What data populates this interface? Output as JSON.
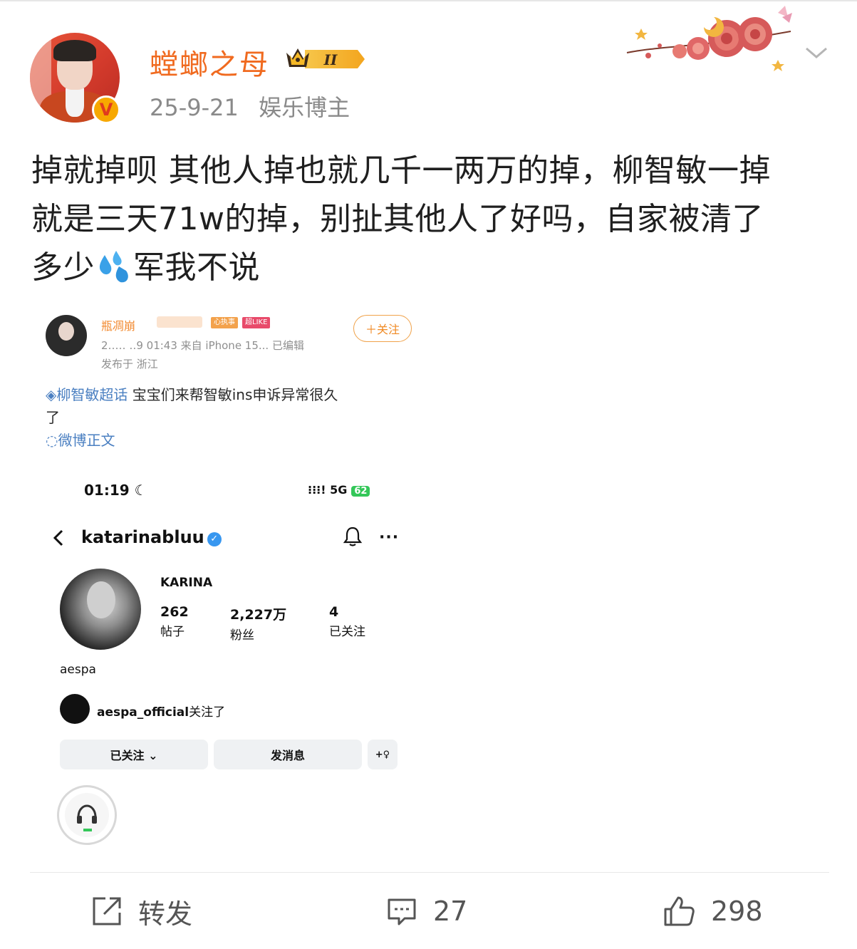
{
  "post": {
    "username": "螳螂之母",
    "vip_label": "II",
    "date": "25-9-21",
    "user_tag": "娱乐博主",
    "text_line1": "掉就掉呗  其他人掉也就几千一两万的掉，柳智敏一掉",
    "text_line2": "就是三天71w的掉，别扯其他人了好吗，自家被清了",
    "text_line3a": "多少",
    "text_line3b": "军我不说"
  },
  "embed": {
    "name_fragment": "瓶凋崩",
    "tag1": "心执事",
    "tag2": "超LIKE",
    "follow": "＋关注",
    "time_line": "2…‥ ‥9 01:43  来自 iPhone 15...  已编辑",
    "location": "发布于 浙江",
    "topic": "◈柳智敏超话",
    "text": " 宝宝们来帮智敏ins申诉异常很久了",
    "link": "◌微博正文"
  },
  "phone": {
    "time": "01:19 ☾",
    "signal": "⁝⁝⁝! 5G",
    "battery": "62"
  },
  "instagram": {
    "username": "katarinabluu",
    "verified": "✓",
    "more": "···",
    "display_name": "KARINA",
    "stats": [
      {
        "value": "262",
        "label": "帖子"
      },
      {
        "value": "2,227万",
        "label": "粉丝"
      },
      {
        "value": "4",
        "label": "已关注"
      }
    ],
    "bio": "aespa",
    "followed_by_user": "aespa_official",
    "followed_by_suffix": "关注了",
    "btn_following": "已关注 ⌄",
    "btn_message": "发消息",
    "btn_add": "+♀"
  },
  "actions": {
    "repost_label": "转发",
    "comment_count": "27",
    "like_count": "298"
  },
  "colors": {
    "username": "#f06a1f",
    "meta": "#8a8a8a",
    "link": "#4a7fc1"
  }
}
